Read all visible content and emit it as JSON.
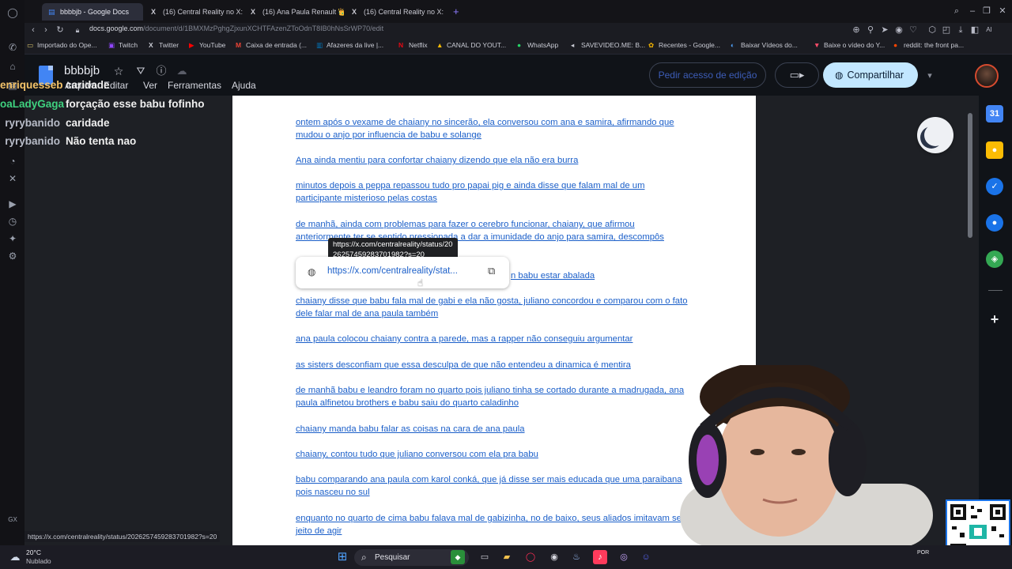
{
  "browser": {
    "tabs": [
      {
        "label": "bbbbjb - Google Docs",
        "icon": "docs-icon",
        "active": true
      },
      {
        "label": "(16) Central Reality no X:",
        "icon": "x-icon"
      },
      {
        "label": "(16) Ana Paula Renault 👑",
        "icon": "x-icon"
      },
      {
        "label": "(16) Central Reality no X:",
        "icon": "x-icon"
      }
    ],
    "new_tab": "+",
    "url_domain": "docs.google.com",
    "url_path": "/document/d/1BMXMzPghgZjxunXCHTFAzenZToOdnT8IB0hNsSrWP70/edit",
    "bookmarks": [
      {
        "label": "Importado do Ope...",
        "icon": "folder-icon"
      },
      {
        "label": "Twitch",
        "icon": "twitch-icon"
      },
      {
        "label": "Twitter",
        "icon": "x-icon"
      },
      {
        "label": "YouTube",
        "icon": "youtube-icon"
      },
      {
        "label": "Caixa de entrada (...",
        "icon": "gmail-icon"
      },
      {
        "label": "Afazeres da live |...",
        "icon": "trello-icon"
      },
      {
        "label": "Netflix",
        "icon": "netflix-icon"
      },
      {
        "label": "CANAL DO YOUT...",
        "icon": "drive-icon"
      },
      {
        "label": "WhatsApp",
        "icon": "whatsapp-icon"
      },
      {
        "label": "SAVEVIDEO.ME: B...",
        "icon": "savevideo-icon"
      },
      {
        "label": "Recentes - Google...",
        "icon": "photos-icon"
      },
      {
        "label": "Baixar Vídeos do...",
        "icon": "download-icon"
      },
      {
        "label": "Baixe o vídeo do Y...",
        "icon": "download-icon"
      },
      {
        "label": "reddit: the front pa...",
        "icon": "reddit-icon"
      }
    ],
    "status_url": "https://x.com/centralreality/status/2026257459283701982?s=20"
  },
  "docs": {
    "title": "bbbbjb",
    "menu": [
      "Arquivo",
      "Editar",
      "Ver",
      "Ferramentas",
      "Ajuda"
    ],
    "request_edit": "Pedir acesso de edição",
    "share": "Compartilhar",
    "paragraphs": [
      "ontem após o vexame de chaiany no sincerão, ela conversou com ana e samira, afirmando que mudou o anjo por influencia de babu e solange",
      "Ana ainda mentiu para confortar chaiany dizendo que ela não era burra",
      "minutos depois a peppa repassou tudo pro papai pig e ainda disse que falam mal de um participante misterioso pelas costas",
      "de manhã, ainda com problemas para fazer o cerebro funcionar, chaiany, que afirmou anteriormente ter se sentido pressionada a dar a imunidade do anjo para samira, descompôs",
      "n babu estar abalada",
      "chaiany disse que babu fala mal de gabi e ela não gosta, juliano concordou e comparou com o fato dele falar mal de ana paula também",
      "ana paula colocou chaiany contra a parede, mas a rapper não conseguiu argumentar",
      "as sisters desconfiam que essa desculpa de que não entendeu a dinamica é mentira",
      "de manhã babu e leandro foram no quarto pois juliano tinha se cortado durante a madrugada, ana paula alfinetou brothers e babu saiu do quarto caladinho",
      "chaiany manda babu falar as coisas na cara de ana paula",
      "chaiany, contou tudo que juliano conversou com ela pra babu",
      "babu comparando ana paula com karol conká, que já disse ser mais educada que uma paraibana pois nasceu no sul",
      "enquanto no quarto de cima babu falava mal de gabizinha, no de baixo, seus aliados imitavam seu jeito de agir"
    ],
    "link_tooltip": "https://x.com/centralreality/status/2026257459283701982?s=20",
    "link_card_url": "https://x.com/centralreality/stat..."
  },
  "chat": [
    {
      "user": "enriquesseb",
      "message": "caridade",
      "color": "#f5c46a"
    },
    {
      "user": "oaLadyGaga",
      "message": "forçação esse babu fofinho",
      "color": "#3fd17f"
    },
    {
      "user": "ryrybanido",
      "message": "caridade",
      "color": "#b8bcc8"
    },
    {
      "user": "ryrybanido",
      "message": "Não tenta nao",
      "color": "#b8bcc8"
    }
  ],
  "taskbar": {
    "weather_temp": "20°C",
    "weather_desc": "Nublado",
    "search": "Pesquisar",
    "tray_text": "POR"
  },
  "opera_sidebar_label": "GX"
}
